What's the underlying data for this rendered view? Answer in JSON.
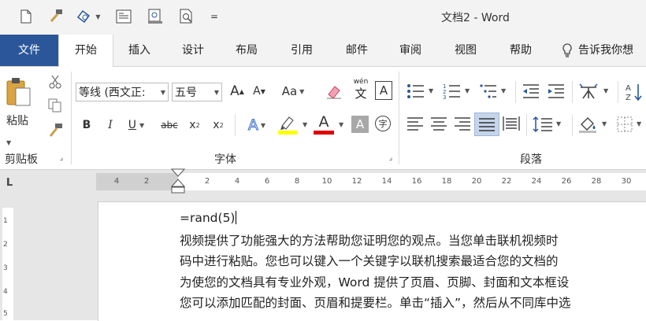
{
  "window": {
    "title": "文档2 - Word"
  },
  "qat": {
    "customize_label": "="
  },
  "tabs": [
    {
      "label": "文件"
    },
    {
      "label": "开始"
    },
    {
      "label": "插入"
    },
    {
      "label": "设计"
    },
    {
      "label": "布局"
    },
    {
      "label": "引用"
    },
    {
      "label": "邮件"
    },
    {
      "label": "审阅"
    },
    {
      "label": "视图"
    },
    {
      "label": "帮助"
    }
  ],
  "tellme": {
    "label": "告诉我你想"
  },
  "clipboard": {
    "paste_label": "粘贴",
    "group_label": "剪贴板"
  },
  "font": {
    "family": "等线 (西文正:",
    "size": "五号",
    "grow_label": "A",
    "shrink_label": "A",
    "case_label": "Aa",
    "phonetic_top": "wén",
    "phonetic_bottom": "文",
    "border_char_label": "A",
    "bold_label": "B",
    "italic_label": "I",
    "underline_label": "U",
    "strike_label": "abc",
    "sub_label": "x",
    "sub_mark": "2",
    "sup_label": "x",
    "sup_mark": "2",
    "effects_label": "A",
    "color_label": "A",
    "shading_label": "A",
    "enclose_label": "字",
    "group_label": "字体"
  },
  "paragraph": {
    "group_label": "段落"
  },
  "ruler": {
    "corner_label": "L",
    "ticks": [
      "4",
      "2",
      "2",
      "4",
      "6",
      "8",
      "10",
      "12",
      "14",
      "16",
      "18",
      "20",
      "22",
      "24",
      "26",
      "28",
      "30"
    ]
  },
  "left_ruler": {
    "ticks": [
      "1",
      "2",
      "3",
      "4",
      "5"
    ]
  },
  "colors": {
    "file_tab": "#2b579a",
    "highlight": "#ffff00",
    "font_color": "#e00000",
    "justify_active": "#c5d5ea"
  },
  "document": {
    "lines": [
      "=rand(5)",
      "视频提供了功能强大的方法帮助您证明您的观点。当您单击联机视频时",
      "码中进行粘贴。您也可以键入一个关键字以联机搜索最适合您的文档的",
      "为使您的文档具有专业外观，Word 提供了页眉、页脚、封面和文本框设",
      "您可以添加匹配的封面、页眉和提要栏。单击“插入”，然后从不同库中选"
    ]
  }
}
